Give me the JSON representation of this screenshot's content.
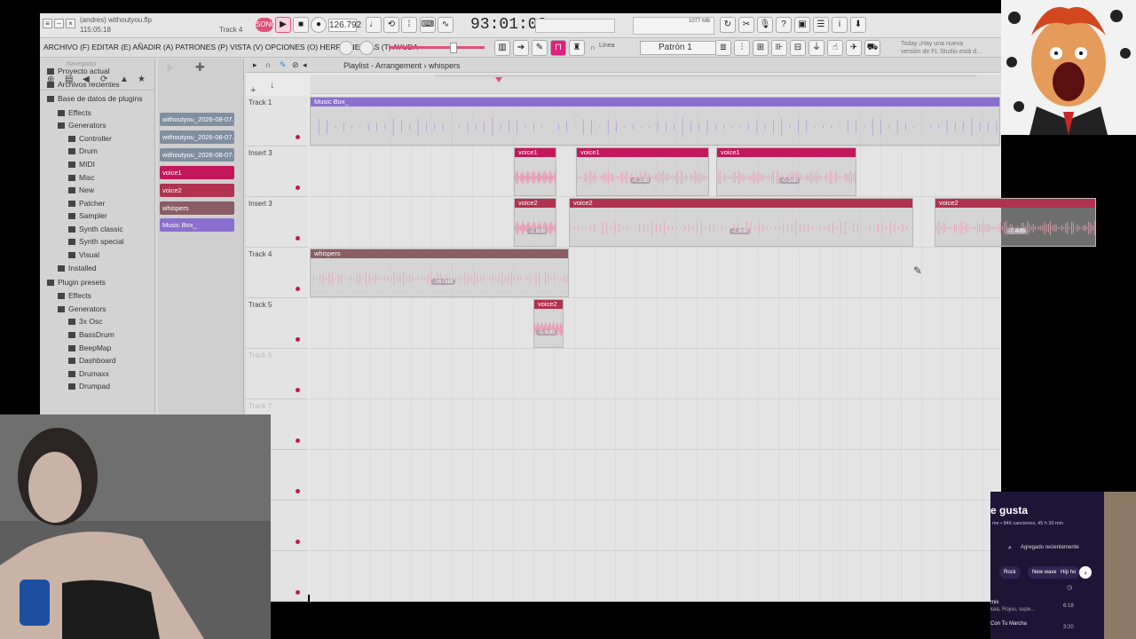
{
  "title": {
    "project": "(andres) withoutyou.flp",
    "counter": "115:05:18",
    "hint": "Track 4"
  },
  "transport": {
    "mode": "SONG",
    "tempo": "126.792",
    "time": "93:01:00",
    "memory": "1077 MB"
  },
  "menu": {
    "text": "ARCHIVO (F) EDITAR (E) AÑADIR (A) PATRONES (P) VISTA (V) OPCIONES (O) HERRAMIENTAS (T) AYUDA",
    "line_mode": "Línea",
    "pattern": "Patrón 1",
    "news": "Today ¡Hay una nueva versión de FL Studio está d..."
  },
  "browser": {
    "header": "Navegador",
    "items": [
      {
        "label": "Proyecto actual",
        "indent": 0
      },
      {
        "label": "Archivos recientes",
        "indent": 0
      },
      {
        "label": "Base de datos de plugins",
        "indent": 0
      },
      {
        "label": "Effects",
        "indent": 1
      },
      {
        "label": "Generators",
        "indent": 1
      },
      {
        "label": "Controller",
        "indent": 2
      },
      {
        "label": "Drum",
        "indent": 2
      },
      {
        "label": "MIDI",
        "indent": 2
      },
      {
        "label": "Misc",
        "indent": 2
      },
      {
        "label": "New",
        "indent": 2
      },
      {
        "label": "Patcher",
        "indent": 2
      },
      {
        "label": "Sampler",
        "indent": 2
      },
      {
        "label": "Synth classic",
        "indent": 2
      },
      {
        "label": "Synth special",
        "indent": 2
      },
      {
        "label": "Visual",
        "indent": 2
      },
      {
        "label": "Installed",
        "indent": 1
      },
      {
        "label": "Plugin presets",
        "indent": 0
      },
      {
        "label": "Effects",
        "indent": 1
      },
      {
        "label": "Generators",
        "indent": 1
      },
      {
        "label": "3x Osc",
        "indent": 2
      },
      {
        "label": "BassDrum",
        "indent": 2
      },
      {
        "label": "BeepMap",
        "indent": 2
      },
      {
        "label": "Dashboard",
        "indent": 2
      },
      {
        "label": "Drumaxx",
        "indent": 2
      },
      {
        "label": "Drumpad",
        "indent": 2
      }
    ]
  },
  "clips": [
    {
      "label": "withoutyou_2026-08-07...",
      "color": "#7f8fa0"
    },
    {
      "label": "withoutyou_2026-08-07...",
      "color": "#7f8fa0"
    },
    {
      "label": "withoutyou_2026-08-07...",
      "color": "#7f8fa0"
    },
    {
      "label": "voice1",
      "color": "#c2185b"
    },
    {
      "label": "voice2",
      "color": "#b0324e"
    },
    {
      "label": "whispers",
      "color": "#8a5d65"
    },
    {
      "label": "Music Box_",
      "color": "#8b6fcf"
    }
  ],
  "playlist": {
    "breadcrumb": "Playlist - Arrangement › whispers",
    "tracks": [
      "Track 1",
      "Insert 3",
      "Insert 3",
      "Track 4",
      "Track 5",
      "Track 6",
      "Track 7",
      "",
      "",
      ""
    ],
    "clips": [
      {
        "track": 0,
        "name": "Music Box_",
        "color": "#8b6fcf",
        "db": ""
      },
      {
        "track": 1,
        "name": "voice1",
        "color": "#c2185b",
        "db": ""
      },
      {
        "track": 1,
        "name": "voice1",
        "color": "#c2185b",
        "db": "-0.2dB"
      },
      {
        "track": 1,
        "name": "voice1",
        "color": "#c2185b",
        "db": "-0.2dB"
      },
      {
        "track": 2,
        "name": "voice2",
        "color": "#b0324e",
        "db": "-2.8dB"
      },
      {
        "track": 2,
        "name": "voice2",
        "color": "#b0324e",
        "db": "-2.8dB"
      },
      {
        "track": 2,
        "name": "voice2",
        "color": "#b0324e",
        "db": "-7.4dB"
      },
      {
        "track": 3,
        "name": "whispers",
        "color": "#8a5d65",
        "db": "-16.0dB"
      },
      {
        "track": 4,
        "name": "voice2",
        "color": "#b0324e",
        "db": "-5.6dB"
      }
    ]
  },
  "spotify": {
    "title": "e gusta",
    "subtitle": "me • 846 canciones, 45 h 30 min",
    "sort": "Agregado recientemente",
    "chips": [
      "Rock",
      "New wave",
      "Hip ho"
    ],
    "rows": [
      {
        "title": "mix",
        "artists": "kaa, Rojuu, supe...",
        "time": "6:18"
      },
      {
        "title": "Con Tu Marcha",
        "artists": "",
        "time": "3:20"
      }
    ]
  }
}
